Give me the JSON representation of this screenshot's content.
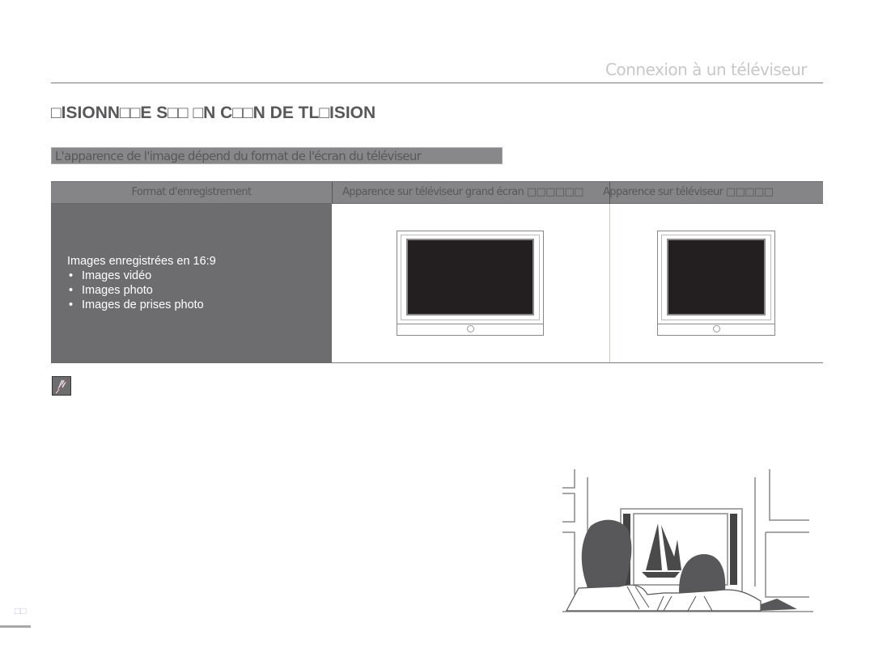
{
  "header": {
    "section_title": "Connexion à un téléviseur"
  },
  "page": {
    "heading": "□ISIONN□□E S□□ □N C□□N DE TL□ISION",
    "info_bar": "L'apparence de l'image dépend du format de l'écran du téléviseur",
    "page_number": "□□"
  },
  "table": {
    "headers": [
      "Format d'enregistrement",
      "Apparence sur téléviseur grand écran □□□□□□",
      "Apparence sur téléviseur □□□□□"
    ],
    "row": {
      "format_title": "Images enregistrées en 16:9",
      "format_items": [
        "Images vidéo",
        "Images photo",
        "Images de prises photo"
      ],
      "widescreen_tv": "16:9 television display",
      "standard_tv": "4:3 television display"
    }
  },
  "icons": {
    "note": "note-pencil-icon",
    "illustration": "couple-watching-tv-illustration"
  }
}
